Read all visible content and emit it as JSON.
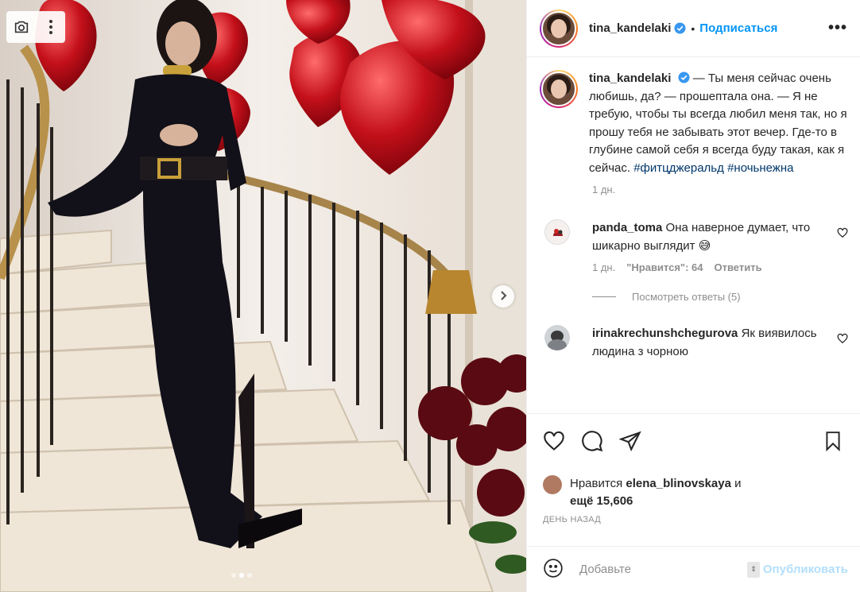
{
  "post": {
    "username": "tina_kandelaki",
    "follow_label": "Подписаться",
    "more_label": "•••",
    "separator": "•"
  },
  "caption": {
    "username": "tina_kandelaki",
    "text": "— Ты меня сейчас очень любишь, да? — прошептала она. — Я не требую, чтобы ты всегда любил меня так, но я прошу тебя не забывать этот вечер. Где-то в глубине самой себя я всегда буду такая, как я сейчас.",
    "hashtag_1": "#фитцджеральд",
    "hashtag_2": "#ночьнежна",
    "time": "1 дн."
  },
  "comments": [
    {
      "username": "panda_toma",
      "text": "Она наверное думает, что шикарно выглядит 😅",
      "time": "1 дн.",
      "likes": "\"Нравится\": 64",
      "reply": "Ответить",
      "view_replies": "Посмотреть ответы (5)"
    },
    {
      "username": "irinakrechunshchegurova",
      "text": "Як виявилось людина з чорною"
    }
  ],
  "likes": {
    "prefix": "Нравится",
    "user": "elena_blinovskaya",
    "and": "и",
    "more": "ещё 15,606"
  },
  "timestamp": "ДЕНЬ НАЗАД",
  "add_comment": {
    "placeholder": "Добавьте",
    "post_label": "Опубликовать"
  },
  "icons": {
    "camera": "camera-icon",
    "menu": "vertical-dots-icon",
    "next": "chevron-right-icon",
    "verified": "verified-badge-icon",
    "like": "heart-icon",
    "comment": "comment-bubble-icon",
    "share": "paper-plane-icon",
    "save": "bookmark-icon",
    "emoji": "smiley-icon"
  },
  "colors": {
    "accent": "#0095f6",
    "post_disabled": "#b2dffc",
    "muted": "#8e8e8e"
  }
}
